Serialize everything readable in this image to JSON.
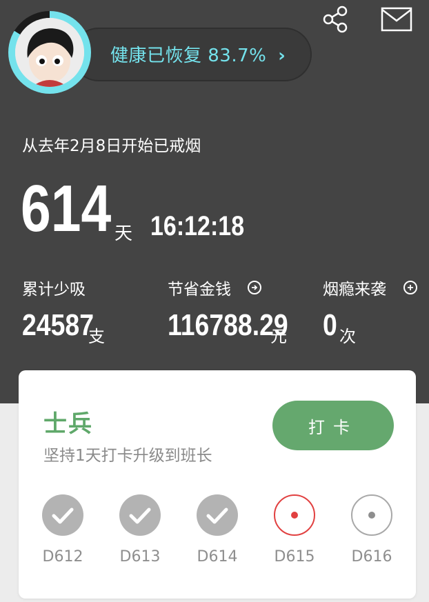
{
  "header": {
    "share_icon": "share-icon",
    "mail_icon": "mail-icon",
    "health_label": "健康已恢复 83.7%",
    "health_chevron": "›",
    "health_progress": 0.837,
    "ring_color": "#74e2ec"
  },
  "summary": {
    "since_text": "从去年2月8日开始已戒烟",
    "days": "614",
    "days_unit": "天",
    "clock": "16:12:18"
  },
  "stats": [
    {
      "label": "累计少吸",
      "value": "24587",
      "unit": "支",
      "icon": ""
    },
    {
      "label": "节省金钱",
      "value": "116788.29",
      "unit": "元",
      "icon": "arrow-right-circle-icon"
    },
    {
      "label": "烟瘾来袭",
      "value": "0",
      "unit": "次",
      "icon": "plus-circle-icon"
    }
  ],
  "card": {
    "rank": "士兵",
    "rank_sub": "坚持1天打卡升级到班长",
    "button_label": "打卡",
    "accent": "#65a86e",
    "days": [
      {
        "label": "D612",
        "state": "done"
      },
      {
        "label": "D613",
        "state": "done"
      },
      {
        "label": "D614",
        "state": "done"
      },
      {
        "label": "D615",
        "state": "current"
      },
      {
        "label": "D616",
        "state": "future"
      }
    ]
  }
}
